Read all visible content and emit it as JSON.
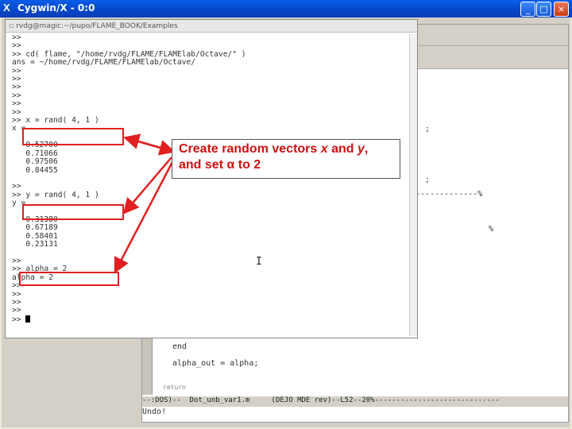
{
  "window": {
    "title": "Cygwin/X - 0:0",
    "icon": "x-logo-icon",
    "buttons": {
      "minimize": "_",
      "maximize": "□",
      "close": "×"
    }
  },
  "terminal": {
    "title": "rvdg@magic:~/pupo/FLAME_BOOK/Examples",
    "lines": [
      ">>",
      ">>",
      ">> cd( flame, \"/home/rvdg/FLAME/FLAMElab/Octave/\" )",
      "ans = ~/home/rvdg/FLAME/FLAMElab/Octave/",
      ">>",
      ">>",
      ">>",
      ">>",
      ">>",
      ">>",
      ">> x = rand( 4, 1 )",
      "x =",
      "",
      "   0.52700",
      "   0.71066",
      "   0.97506",
      "   0.84455",
      "",
      ">>",
      ">> y = rand( 4, 1 )",
      "y =",
      "",
      "   0.31380",
      "   0.67189",
      "   0.58401",
      "   0.23131",
      "",
      ">>",
      ">> alpha = 2",
      "alpha = 2",
      ">>",
      ">>",
      ">>",
      ">>",
      ">> "
    ]
  },
  "editor": {
    "code_lines": [
      ";",
      ";",
      "--------------%",
      "%",
      "end",
      "alpha_out = alpha;",
      "return"
    ],
    "modeline": "--:DOS)--  Dot_unb_var1.m     (DEJO MDE rev)--L52--20%-----------------------------",
    "minibuffer": "Undo!"
  },
  "annotation": {
    "line1_pre": "Create random vectors ",
    "line1_x": "x",
    "line1_mid": " and ",
    "line1_y": "y",
    "line1_post": ",",
    "line2_pre": "and set ",
    "line2_alpha": "α",
    "line2_post": " to 2"
  },
  "colors": {
    "title_bar": "#0846c7",
    "highlight": "#e02020",
    "annotation_text": "#cc1111"
  }
}
